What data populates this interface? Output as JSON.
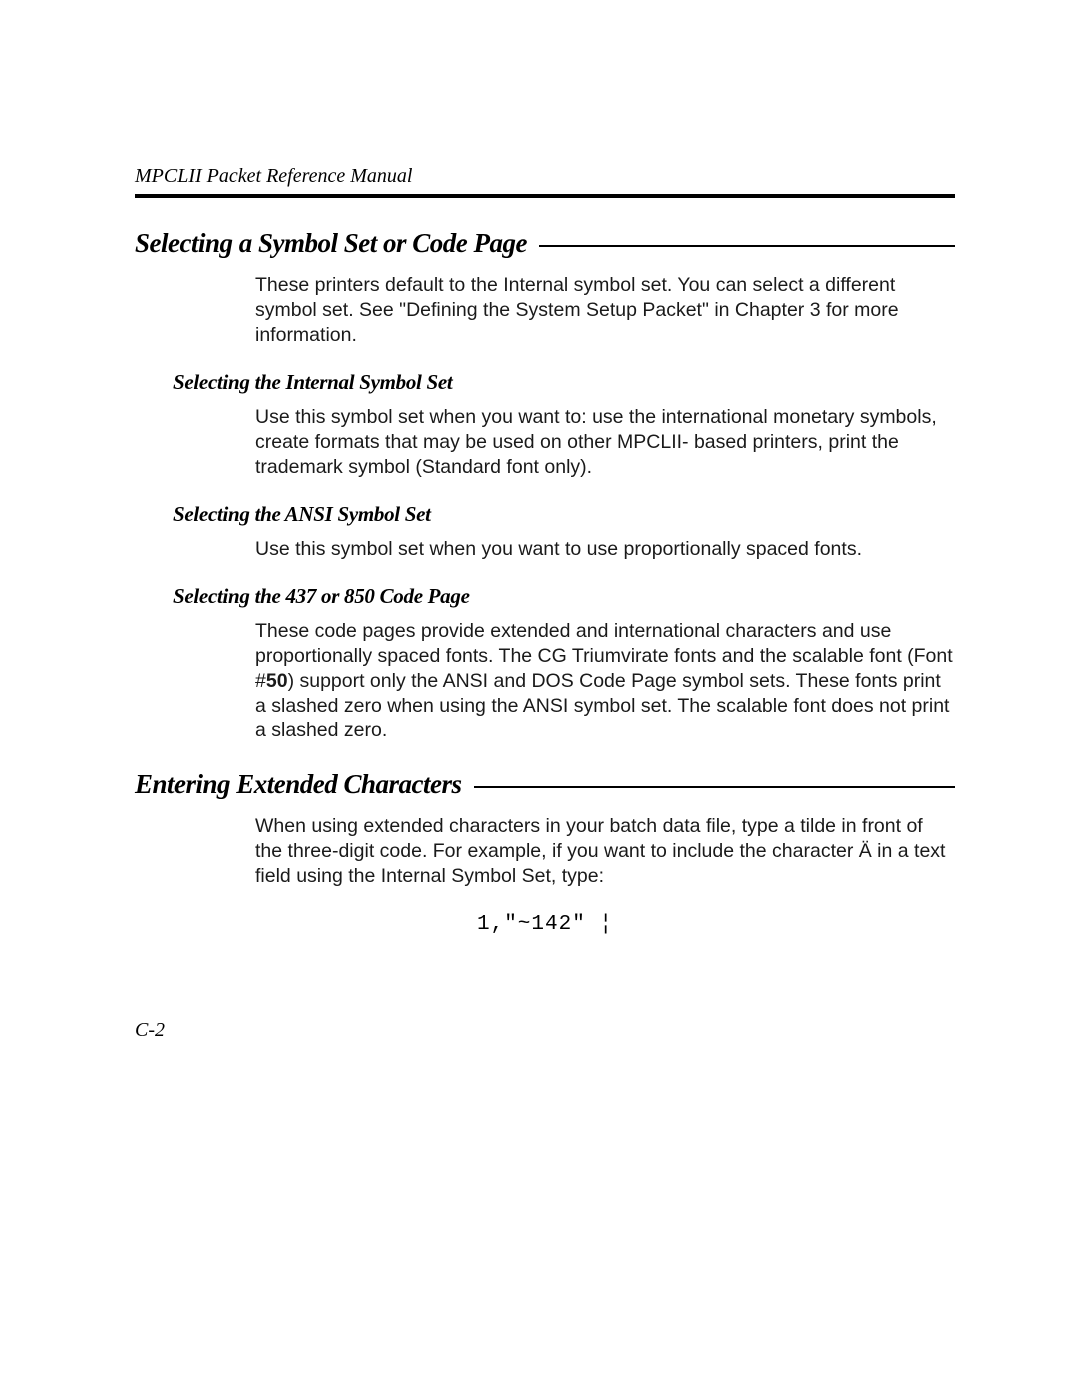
{
  "runningHead": "MPCLII Packet Reference Manual",
  "section1": {
    "title": "Selecting a Symbol Set or Code Page",
    "intro": "These printers default to the Internal symbol set.  You can select a different symbol set.  See \"Defining the System Setup Packet\" in Chapter 3 for more information.",
    "sub1": {
      "title": "Selecting the Internal Symbol Set",
      "body": "Use this symbol set when you want to:  use the international monetary symbols, create formats that may be used on other MPCLII- based printers, print the trademark symbol (Standard font only)."
    },
    "sub2": {
      "title": "Selecting the ANSI Symbol Set",
      "body": "Use this symbol set when you want to use proportionally spaced fonts."
    },
    "sub3": {
      "title": "Selecting the 437 or 850 Code Page",
      "body_pre": "These code pages provide extended and international characters and use proportionally spaced fonts.  The CG Triumvirate fonts and the scalable font (Font #",
      "body_bold": "50",
      "body_post": ") support only the ANSI and DOS Code Page symbol sets.  These fonts print a slashed zero when using the ANSI symbol set.  The scalable font does not print a slashed zero."
    }
  },
  "section2": {
    "title": "Entering Extended Characters",
    "body": "When using extended characters in your batch data file, type a tilde in front of the three-digit code.  For example, if you want to include the character Ä in a text field using the Internal Symbol Set, type:",
    "code": "1,\"~142\" ¦"
  },
  "pageNumber": "C-2"
}
